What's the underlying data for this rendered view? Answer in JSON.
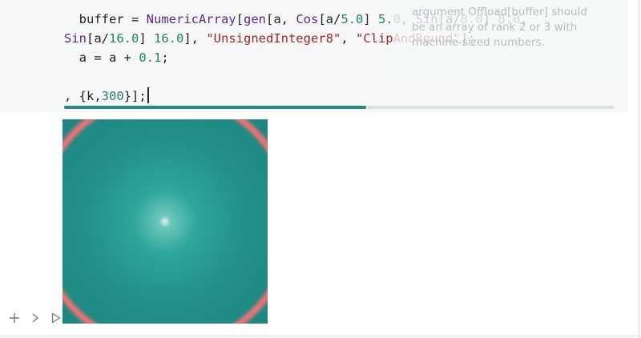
{
  "editor": {
    "lines": [
      [
        {
          "t": "  buffer = "
        },
        {
          "t": "NumericArray",
          "c": "kw"
        },
        {
          "t": "["
        },
        {
          "t": "gen",
          "c": "kw"
        },
        {
          "t": "[a, "
        },
        {
          "t": "Cos",
          "c": "kw"
        },
        {
          "t": "[a/"
        },
        {
          "t": "5.0",
          "c": "num"
        },
        {
          "t": "] "
        },
        {
          "t": "5.0",
          "c": "num"
        },
        {
          "t": ", "
        },
        {
          "t": "Sin",
          "c": "kw"
        },
        {
          "t": "[a/"
        },
        {
          "t": "8.0",
          "c": "num"
        },
        {
          "t": "] "
        },
        {
          "t": "8.0",
          "c": "num"
        },
        {
          "t": ","
        }
      ],
      [
        {
          "t": "Sin",
          "c": "kw"
        },
        {
          "t": "[a/"
        },
        {
          "t": "16.0",
          "c": "num"
        },
        {
          "t": "] "
        },
        {
          "t": "16.0",
          "c": "num"
        },
        {
          "t": "], "
        },
        {
          "t": "\"UnsignedInteger8\"",
          "c": "str"
        },
        {
          "t": ", "
        },
        {
          "t": "\"ClipAndRound\"",
          "c": "str"
        },
        {
          "t": "];"
        }
      ],
      [
        {
          "t": "  a = a + "
        },
        {
          "t": "0.1",
          "c": "num"
        },
        {
          "t": ";"
        }
      ],
      [],
      [
        {
          "t": ", {k,"
        },
        {
          "t": "300",
          "c": "num"
        },
        {
          "t": "}];"
        }
      ]
    ]
  },
  "tooltip": {
    "text": "argument Offload[buffer] should be an array of rank 2 or 3 with machine-sized numbers."
  },
  "progress": {
    "fraction": 0.55
  },
  "output": {
    "image_icon": "gradient-ring-image"
  },
  "toolbar": {
    "add_icon": "plus-icon",
    "expand_icon": "chevron-right-icon",
    "run_icon": "play-icon"
  },
  "colors": {
    "keyword": "#5a2a86",
    "number": "#2a7d6a",
    "string": "#a4232c",
    "progress": "#2b8a7d",
    "image_teal": "#22918a",
    "ring": "#ff6f73"
  }
}
